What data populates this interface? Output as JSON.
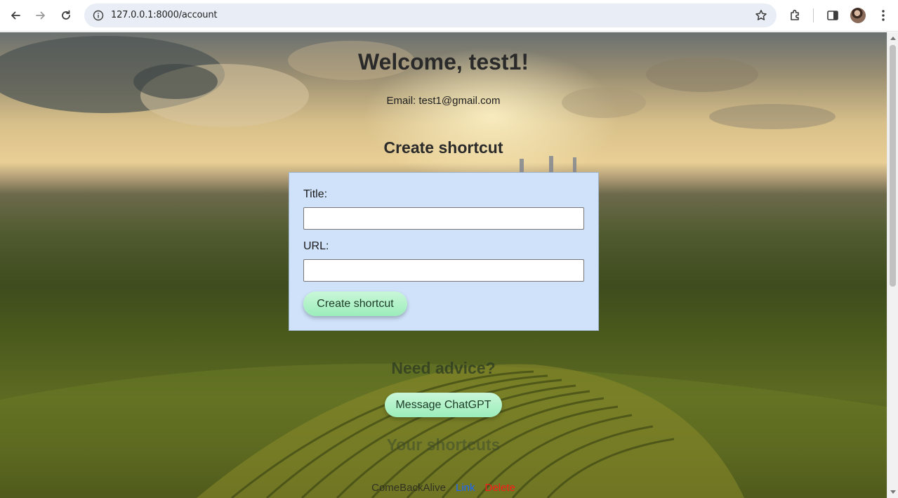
{
  "browser": {
    "url": "127.0.0.1:8000/account",
    "icons": [
      "back-icon",
      "forward-icon",
      "reload-icon",
      "site-info-icon",
      "bookmark-star-icon",
      "extensions-icon",
      "side-panel-icon",
      "profile-avatar",
      "menu-kebab-icon"
    ]
  },
  "page": {
    "welcome": "Welcome, test1!",
    "email": "Email: test1@gmail.com",
    "create_heading": "Create shortcut",
    "form": {
      "title_label": "Title:",
      "title_value": "",
      "url_label": "URL:",
      "url_value": "",
      "submit_label": "Create shortcut"
    },
    "advice_heading": "Need advice?",
    "chatgpt_button": "Message ChatGPT",
    "shortcuts_heading": "Your shortcuts",
    "shortcuts": [
      {
        "title": "ComeBackAlive",
        "link_label": "Link",
        "delete_label": "Delete"
      }
    ]
  },
  "colors": {
    "form_card_bg": "#cfe2fa",
    "button_green": "#b6f3cd",
    "link": "#1a66ff",
    "delete": "#ff1a1a"
  }
}
